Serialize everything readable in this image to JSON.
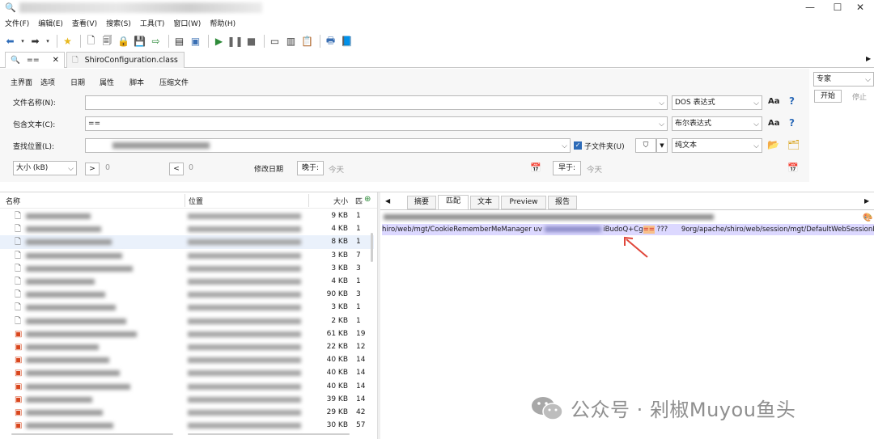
{
  "window": {
    "title": "",
    "controls": [
      "—",
      "☐",
      "✕"
    ]
  },
  "menu": [
    "文件(F)",
    "编辑(E)",
    "查看(V)",
    "搜索(S)",
    "工具(T)",
    "窗口(W)",
    "帮助(H)"
  ],
  "doc_tabs": [
    {
      "label": "==",
      "icon": "search-icon"
    },
    {
      "label": "ShiroConfiguration.class",
      "icon": "file-icon"
    }
  ],
  "search_tabs": [
    "主界面",
    "选项",
    "日期",
    "属性",
    "脚本",
    "压缩文件"
  ],
  "right_panel": {
    "mode": "专家",
    "start": "开始",
    "stop": "停止"
  },
  "form": {
    "filename_label": "文件名称(N):",
    "filename_value": "",
    "filename_mode": "DOS 表达式",
    "contains_label": "包含文本(C):",
    "contains_value": "==",
    "contains_mode": "布尔表达式",
    "location_label": "查找位置(L):",
    "subfolder_label": "子文件夹(U)",
    "text_mode": "纯文本",
    "size_select": "大小 (kB)",
    "size_gt_op": ">",
    "size_gt_value": "0",
    "size_lt_op": "<",
    "size_lt_value": "0",
    "mod_date_label": "修改日期",
    "later_label": "晚于:",
    "later_value": "今天",
    "earlier_label": "早于:",
    "earlier_value": "今天"
  },
  "results": {
    "columns": {
      "name": "名称",
      "location": "位置",
      "size": "大小",
      "extra": "匹"
    },
    "rows": [
      {
        "size": "9 KB",
        "count": "1",
        "type": "file"
      },
      {
        "size": "4 KB",
        "count": "1",
        "type": "file"
      },
      {
        "size": "8 KB",
        "count": "1",
        "type": "file",
        "selected": true
      },
      {
        "size": "3 KB",
        "count": "7",
        "type": "file"
      },
      {
        "size": "3 KB",
        "count": "3",
        "type": "file"
      },
      {
        "size": "4 KB",
        "count": "1",
        "type": "file"
      },
      {
        "size": "90 KB",
        "count": "3",
        "type": "file"
      },
      {
        "size": "3 KB",
        "count": "1",
        "type": "file"
      },
      {
        "size": "2 KB",
        "count": "1",
        "type": "file"
      },
      {
        "size": "61 KB",
        "count": "19",
        "type": "java"
      },
      {
        "size": "22 KB",
        "count": "12",
        "type": "java"
      },
      {
        "size": "40 KB",
        "count": "14",
        "type": "java"
      },
      {
        "size": "40 KB",
        "count": "14",
        "type": "java"
      },
      {
        "size": "40 KB",
        "count": "14",
        "type": "java"
      },
      {
        "size": "39 KB",
        "count": "14",
        "type": "java"
      },
      {
        "size": "29 KB",
        "count": "42",
        "type": "java"
      },
      {
        "size": "30 KB",
        "count": "57",
        "type": "java"
      }
    ]
  },
  "preview": {
    "tabs": [
      "摘要",
      "匹配",
      "文本",
      "Preview",
      "报告"
    ],
    "active_tab": "匹配",
    "match_line_1": "hiro/web/mgt/CookieRememberMeManager uv",
    "match_line_2": "iBudoQ+Cg",
    "match_hit": "==",
    "match_line_3": " ???",
    "match_line_4": "9org/apache/shiro/web/session/mgt/DefaultWebSessionM"
  },
  "watermark": "公众号 · 剁椒Muyou鱼头",
  "colors": {
    "accent": "#2d6bb8",
    "selection": "#cfe0f6",
    "match_highlight": "#f8c08a",
    "match_line_bg": "#dcd8ff",
    "java_icon": "#d9461d",
    "arrow": "#e0463a"
  }
}
